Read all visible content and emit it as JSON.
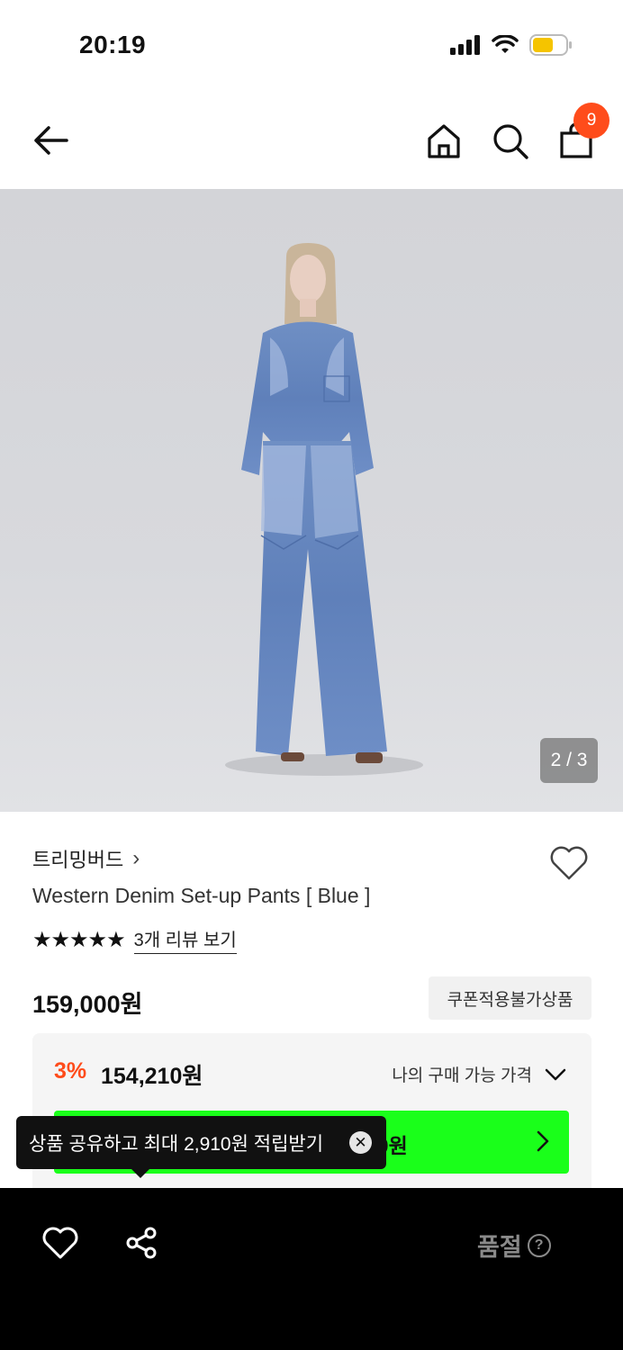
{
  "status_bar": {
    "time": "20:19",
    "icons": [
      "signal-icon",
      "wifi-icon",
      "battery-icon"
    ],
    "battery_color": "#f5c400"
  },
  "header": {
    "icons": [
      "back-arrow-icon",
      "home-icon",
      "search-icon",
      "shopping-bag-icon"
    ],
    "cart_count": "9",
    "badge_color": "#ff4c1b"
  },
  "gallery": {
    "indicator": "2 / 3"
  },
  "product": {
    "brand": "트리밍버드",
    "brand_chevron": "›",
    "name": "Western Denim Set-up Pants [ Blue ]",
    "stars": "★★★★★",
    "rating": 5,
    "review_link": "3개 리뷰 보기",
    "price": "159,000원",
    "coupon_tag": "쿠폰적용불가상품"
  },
  "my_price": {
    "discount_rate": "3%",
    "discount_price": "154,210원",
    "toggle_label": "나의 구매 가능 가격",
    "button_amount_visible": "10원",
    "button_color": "#1aff1a",
    "accent_color": "#ff4c1b"
  },
  "tooltip": {
    "text": "상품 공유하고 최대 2,910원 적립받기",
    "close": "✕"
  },
  "bottom_bar": {
    "status": "품절",
    "help": "?"
  }
}
